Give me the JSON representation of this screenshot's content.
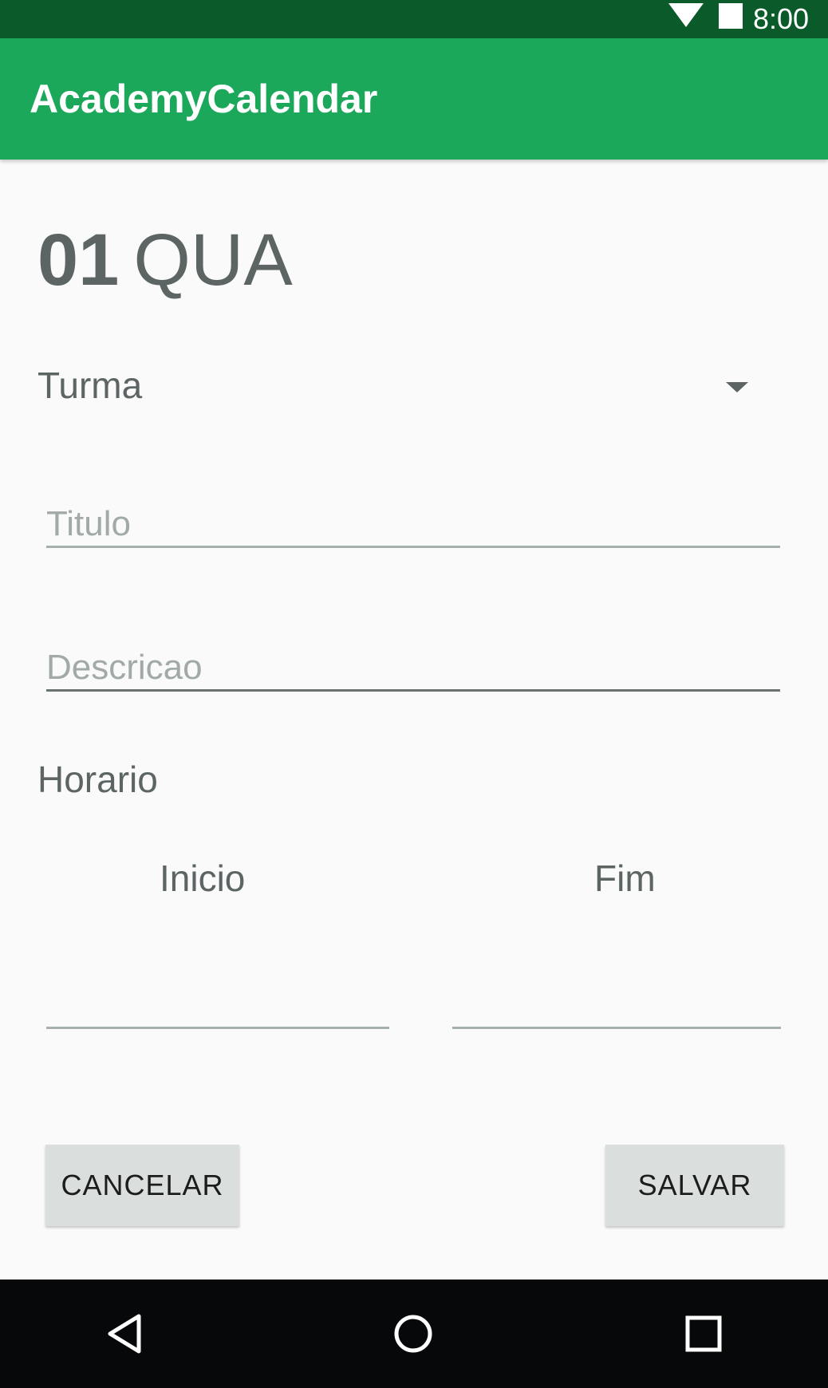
{
  "status_bar": {
    "time": "8:00",
    "icons": [
      "wifi-icon",
      "battery-icon"
    ]
  },
  "app_bar": {
    "title": "AcademyCalendar"
  },
  "date_heading": {
    "day_number": "01",
    "day_name": "QUA"
  },
  "form": {
    "turma_label": "Turma",
    "titulo_placeholder": "Titulo",
    "titulo_value": "",
    "descricao_placeholder": "Descricao",
    "descricao_value": "",
    "horario_label": "Horario",
    "inicio_label": "Inicio",
    "inicio_value": "",
    "fim_label": "Fim",
    "fim_value": ""
  },
  "buttons": {
    "cancel_label": "CANCELAR",
    "save_label": "SALVAR"
  },
  "nav_bar": {
    "icons": [
      "back-icon",
      "home-icon",
      "recents-icon"
    ]
  },
  "colors": {
    "status_bar": "#0a5a2a",
    "app_bar": "#1ba85a",
    "text": "#5c6464",
    "nav_bar": "#06080a"
  }
}
